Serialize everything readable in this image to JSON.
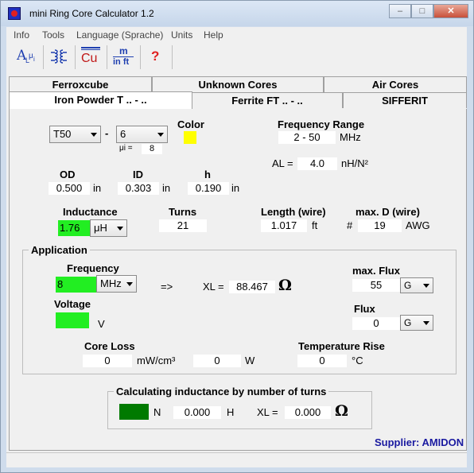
{
  "window": {
    "title": "mini Ring Core Calculator 1.2",
    "btn_min": "–",
    "btn_max": "□",
    "btn_close": "✕"
  },
  "menu": {
    "items": [
      "Info",
      "Tools",
      "Language (Sprache)",
      "Units",
      "Help"
    ]
  },
  "toolbar": {
    "al_label": "A",
    "al_sub": "L",
    "mu_label": "μ",
    "mu_sub": "i",
    "cu_label": "Cu",
    "m_label": "m",
    "inft_label": "in ft",
    "help_label": "?"
  },
  "tabs": {
    "row1": [
      "Ferroxcube",
      "Unknown Cores",
      "Air Cores"
    ],
    "row2": [
      "Iron Powder T .. - ..",
      "Ferrite FT .. - ..",
      "SIFFERIT"
    ],
    "active": "Iron Powder T .. - .."
  },
  "core": {
    "type": "T50",
    "dash": "-",
    "mix": "6",
    "mu_label": "μi =",
    "mu_value": "8",
    "color_label": "Color",
    "color_value": "#ffff00",
    "freq_range_label": "Frequency Range",
    "freq_range_value": "2 - 50",
    "freq_range_unit": "MHz",
    "al_label": "AL =",
    "al_value": "4.0",
    "al_unit": "nH/N²"
  },
  "dims": {
    "od_label": "OD",
    "od_value": "0.500",
    "od_unit": "in",
    "id_label": "ID",
    "id_value": "0.303",
    "id_unit": "in",
    "h_label": "h",
    "h_value": "0.190",
    "h_unit": "in"
  },
  "winding": {
    "inductance_label": "Inductance",
    "inductance_value": "1.76",
    "inductance_unit": "μH",
    "turns_label": "Turns",
    "turns_value": "21",
    "length_label": "Length (wire)",
    "length_value": "1.017",
    "length_unit": "ft",
    "maxd_label": "max. D (wire)",
    "maxd_hash": "#",
    "maxd_value": "19",
    "maxd_unit": "AWG"
  },
  "application": {
    "title": "Application",
    "frequency_label": "Frequency",
    "frequency_value": "8",
    "frequency_unit": "MHz",
    "arrow": "=>",
    "xl_label": "XL =",
    "xl_value": "88.467",
    "ohm": "Ω",
    "maxflux_label": "max. Flux",
    "maxflux_value": "55",
    "maxflux_unit": "G",
    "voltage_label": "Voltage",
    "voltage_value": "",
    "voltage_unit": "V",
    "flux_label": "Flux",
    "flux_value": "0",
    "flux_unit": "G",
    "coreloss_label": "Core Loss",
    "coreloss_value": "0",
    "coreloss_unit": "mW/cm³",
    "watts_value": "0",
    "watts_unit": "W",
    "temp_label": "Temperature Rise",
    "temp_value": "0",
    "temp_unit": "°C"
  },
  "calc": {
    "title": "Calculating inductance by number of turns",
    "n_label": "N",
    "h_value": "0.000",
    "h_unit": "H",
    "xl_label": "XL =",
    "xl_value": "0.000",
    "ohm": "Ω"
  },
  "supplier": "Supplier: AMIDON",
  "colors": {
    "input_green": "#22ee22",
    "calc_green": "#007a00",
    "supplier_blue": "#1a1aa0",
    "help_red": "#e02020"
  }
}
